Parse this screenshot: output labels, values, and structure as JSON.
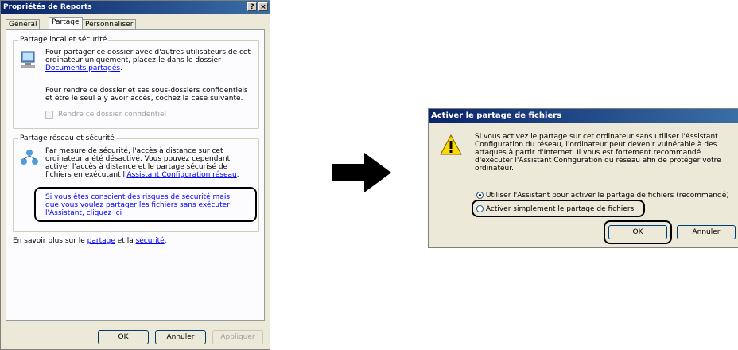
{
  "dialog1": {
    "title": "Propriétés de Reports",
    "help_btn": "?",
    "close_btn": "×",
    "tabs": [
      "Général",
      "Partage",
      "Personnaliser"
    ],
    "local": {
      "legend": "Partage local et sécurité",
      "text1": "Pour partager ce dossier avec d'autres utilisateurs de cet ordinateur uniquement, placez-le dans le dossier",
      "link": "Documents partagés",
      "text2": "Pour rendre ce dossier et ses sous-dossiers confidentiels et être le seul à y avoir accès, cochez la case suivante.",
      "checkbox": "Rendre ce dossier confidentiel"
    },
    "network": {
      "legend": "Partage réseau et sécurité",
      "text": "Par mesure de sécurité, l'accès à distance sur cet ordinateur a été désactivé. Vous pouvez cependant activer l'accès à distance et le partage sécurisé de fichiers en exécutant l'",
      "link_wizard": "Assistant Configuration réseau",
      "risk_link": "Si vous êtes conscient des risques de sécurité mais que vous voulez partager les fichiers sans exécuter l'Assistant, cliquez ici"
    },
    "learn_prefix": "En savoir plus sur le ",
    "learn_link1": "partage",
    "learn_mid": " et la ",
    "learn_link2": "sécurité",
    "buttons": {
      "ok": "OK",
      "cancel": "Annuler",
      "apply": "Appliquer"
    }
  },
  "dialog2": {
    "title": "Activer le partage de fichiers",
    "message": "Si vous activez le partage sur cet ordinateur sans utiliser l'Assistant Configuration du réseau, l'ordinateur peut devenir vulnérable à des attaques à partir d'Internet. Il vous est fortement recommandé d'exécuter l'Assistant Configuration du réseau afin de protéger votre ordinateur.",
    "option1": "Utiliser l'Assistant pour activer le partage de fichiers (recommandé)",
    "option2": "Activer simplement le partage de fichiers",
    "buttons": {
      "ok": "OK",
      "cancel": "Annuler"
    }
  },
  "icons": {
    "arrow": "right-arrow-icon",
    "warning": "warning-icon"
  }
}
